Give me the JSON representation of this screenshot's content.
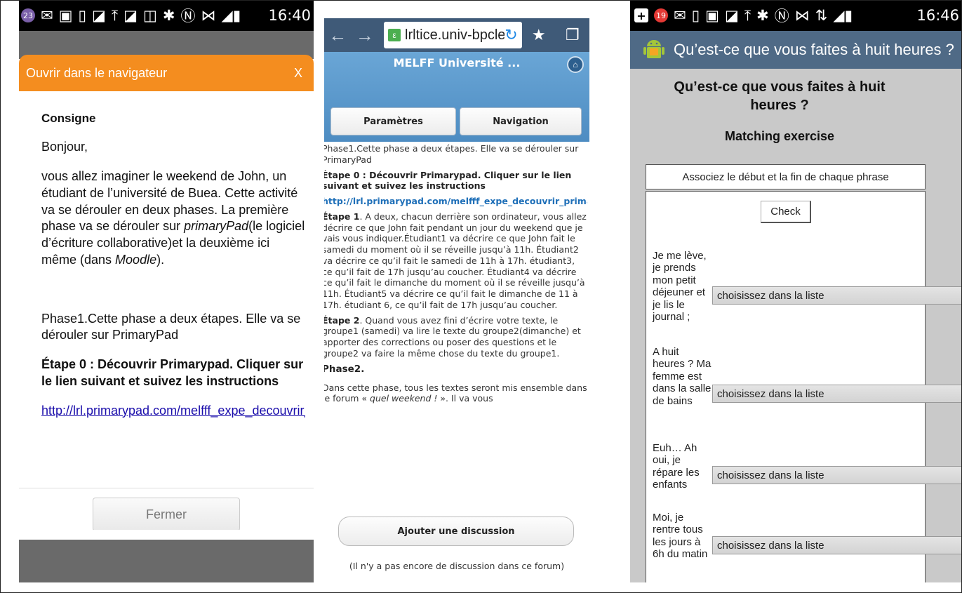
{
  "panel1": {
    "statusbar": {
      "notif_count": "23",
      "time": "16:40"
    },
    "dialog_title": "Ouvrir dans le navigateur",
    "dialog_close": "X",
    "heading": "Consigne",
    "greeting": "Bonjour,",
    "para1_a": "vous allez imaginer le weekend de John, un étudiant de l’université de Buea. Cette activité va se dérouler en deux phases. La première phase va se dérouler sur ",
    "para1_em1": "primaryPad",
    "para1_b": "(le logiciel d’écriture collaborative)et la deuxième ici même (dans ",
    "para1_em2": "Moodle",
    "para1_c": ").",
    "phase1": "Phase1.Cette phase a deux étapes. Elle va se dérouler sur PrimaryPad",
    "etape0": "Étape 0 : Découvrir Primarypad. Cliquer sur le lien suivant et  suivez les instructions",
    "link": "http://lrl.primarypad.com/melfff_expe_decouvrir_primarypad",
    "close_button": "Fermer"
  },
  "panel2": {
    "url": "lrltice.univ-bpclermont.fr",
    "site_title": "MELFF Université ...",
    "tab_settings": "Paramètres",
    "tab_navigation": "Navigation",
    "phase1": "Phase1.Cette phase a deux étapes. Elle va se dérouler sur PrimaryPad",
    "etape0": "Étape 0 : Découvrir Primarypad. Cliquer sur le lien suivant et  suivez les instructions",
    "link": "http://lrl.primarypad.com/melfff_expe_decouvrir_primarypad",
    "etape1_label": "Étape 1",
    "etape1_text": ". A deux, chacun derrière son ordinateur, vous allez décrire ce  que John fait pendant un jour  du weekend que je vais vous indiquer.Étudiant1 va décrire  ce que John fait le samedi du moment où il se réveille jusqu’à 11h. Étudiant2 va décrire ce qu’il fait le samedi de 11h à 17h. étudiant3, ce qu’il fait  de 17h jusqu’au coucher. Étudiant4 va décrire ce qu’il fait le dimanche du moment où il se réveille jusqu’à 11h. Étudiant5 va décrire ce qu’il fait le dimanche de 11 à 17h. étudiant 6, ce qu’il fait de 17h jusqu’au coucher.",
    "etape2_label": "Étape 2",
    "etape2_text": ". Quand vous avez fini d’écrire votre texte, le groupe1 (samedi) va lire le texte du groupe2(dimanche) et apporter des corrections ou poser des questions et le groupe2 va faire la même chose du texte du groupe1.",
    "phase2_heading": "Phase2.",
    "phase2_text_a": "Dans cette phase, tous les textes seront  mis ensemble dans le forum «  ",
    "phase2_em": "quel weekend !",
    "phase2_text_b": " ». Il va vous",
    "add_button": "Ajouter une discussion",
    "empty_message": "(Il n'y a pas encore de discussion dans ce forum)"
  },
  "panel3": {
    "statusbar": {
      "notif_count": "19",
      "time": "16:46"
    },
    "app_title": "Qu’est-ce que vous faites à huit heures ?",
    "page_title": "Qu’est-ce que vous faites à huit heures ?",
    "subtitle": "Matching exercise",
    "instruction": "Associez le début et la fin de chaque phrase",
    "check_button": "Check",
    "select_placeholder": "choisissez dans la liste",
    "rows": [
      {
        "text": "Je me lève, je prends mon petit déjeuner et je lis le journal ;"
      },
      {
        "text": "A huit heures ? Ma femme est dans la salle de bains"
      },
      {
        "text": "Euh… Ah oui, je répare les enfants"
      },
      {
        "text": "Moi, je rentre tous les jours à 6h du matin"
      }
    ]
  }
}
